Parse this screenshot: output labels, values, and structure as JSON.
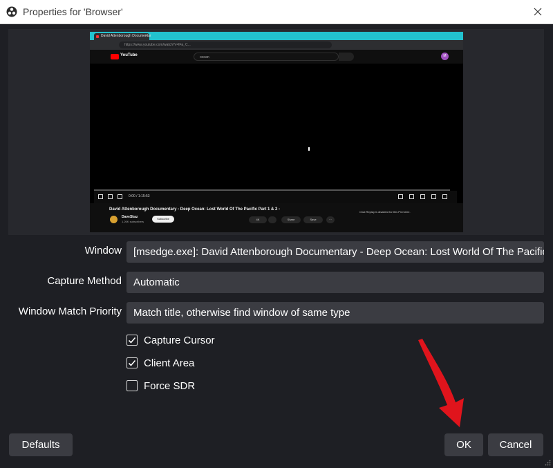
{
  "window": {
    "title": "Properties for 'Browser'",
    "app_icon": "obs-logo-icon",
    "close_icon": "close-icon"
  },
  "preview": {
    "tab_title": "David Attenborough Documentar",
    "url": "https://www.youtube.com/watch?v=lFa_C...",
    "logo_text": "YouTube",
    "search_text": "ocean",
    "avatar_letter": "M",
    "time": "0:00 / 1:15:53",
    "video_title": "David Attenborough Documentary - Deep Ocean: Lost World Of The Pacific Part 1 & 2 -",
    "channel": "DaveSkaz",
    "subscribers": "1.26K subscribers",
    "subscribe": "Subscribe",
    "likes": "4K",
    "share": "Share",
    "save": "Save",
    "more": "···",
    "chat_notice": "Chat Replay is disabled for this Premiere."
  },
  "form": {
    "window_label": "Window",
    "window_value": "[msedge.exe]: David Attenborough Documentary - Deep Ocean: Lost World Of The Pacific",
    "capture_method_label": "Capture Method",
    "capture_method_value": "Automatic",
    "match_priority_label": "Window Match Priority",
    "match_priority_value": "Match title, otherwise find window of same type"
  },
  "checkboxes": [
    {
      "label": "Capture Cursor",
      "checked": true
    },
    {
      "label": "Client Area",
      "checked": true
    },
    {
      "label": "Force SDR",
      "checked": false
    }
  ],
  "buttons": {
    "defaults": "Defaults",
    "ok": "OK",
    "cancel": "Cancel"
  },
  "colors": {
    "dialog_bg": "#1e1f24",
    "field_bg": "#3b3c42",
    "annotation_arrow": "#e0141c"
  }
}
